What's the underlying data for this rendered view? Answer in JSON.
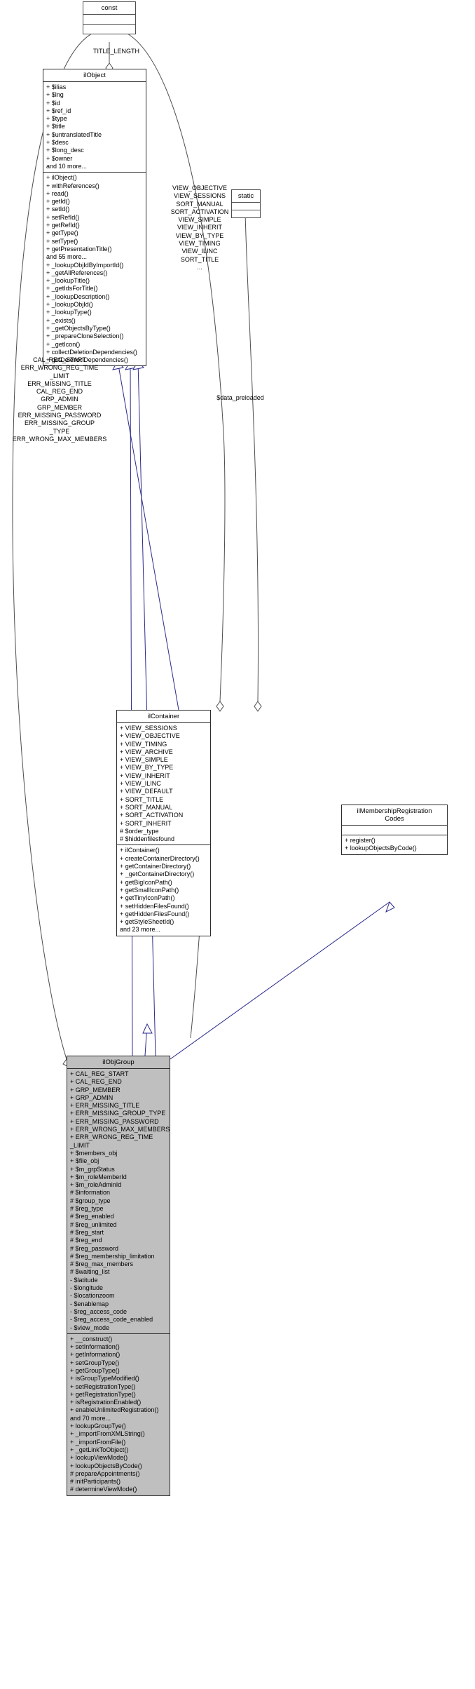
{
  "diagram": {
    "type": "uml-class-diagram",
    "subject": "ilObjGroup"
  },
  "classes": {
    "const": {
      "name": "const",
      "attributes": [],
      "operations": []
    },
    "static": {
      "name": "static",
      "attributes": [],
      "operations": []
    },
    "ilObject": {
      "name": "ilObject",
      "attributes": [
        "+ $ilias",
        "+ $lng",
        "+ $id",
        "+ $ref_id",
        "+ $type",
        "+ $title",
        "+ $untranslatedTitle",
        "+ $desc",
        "+ $long_desc",
        "+ $owner",
        "and 10 more..."
      ],
      "operations": [
        "+ ilObject()",
        "+ withReferences()",
        "+ read()",
        "+ getId()",
        "+ setId()",
        "+ setRefId()",
        "+ getRefId()",
        "+ getType()",
        "+ setType()",
        "+ getPresentationTitle()",
        "and 55 more...",
        "+ _lookupObjIdByImportId()",
        "+ _getAllReferences()",
        "+ _lookupTitle()",
        "+ _getIdsForTitle()",
        "+ _lookupDescription()",
        "+ _lookupObjId()",
        "+ _lookupType()",
        "+ _exists()",
        "+ _getObjectsByType()",
        "+ _prepareCloneSelection()",
        "+ _getIcon()",
        "+ collectDeletionDependencies()",
        "+ getDeletionDependencies()"
      ]
    },
    "ilContainer": {
      "name": "ilContainer",
      "attributes": [
        "+ VIEW_SESSIONS",
        "+ VIEW_OBJECTIVE",
        "+ VIEW_TIMING",
        "+ VIEW_ARCHIVE",
        "+ VIEW_SIMPLE",
        "+ VIEW_BY_TYPE",
        "+ VIEW_INHERIT",
        "+ VIEW_ILINC",
        "+ VIEW_DEFAULT",
        "+ SORT_TITLE",
        "+ SORT_MANUAL",
        "+ SORT_ACTIVATION",
        "+ SORT_INHERIT",
        "# $order_type",
        "# $hiddenfilesfound"
      ],
      "operations": [
        "+ ilContainer()",
        "+ createContainerDirectory()",
        "+ getContainerDirectory()",
        "+ _getContainerDirectory()",
        "+ getBigIconPath()",
        "+ getSmallIconPath()",
        "+ getTinyIconPath()",
        "+ setHiddenFilesFound()",
        "+ getHiddenFilesFound()",
        "+ getStyleSheetId()",
        "and 23 more..."
      ]
    },
    "ilMembershipRegistrationCodes": {
      "name": "ilMembershipRegistration\nCodes",
      "attributes": [],
      "operations": [
        "+ register()",
        "+ lookupObjectsByCode()"
      ]
    },
    "ilObjGroup": {
      "name": "ilObjGroup",
      "attributes": [
        "+ CAL_REG_START",
        "+ CAL_REG_END",
        "+ GRP_MEMBER",
        "+ GRP_ADMIN",
        "+ ERR_MISSING_TITLE",
        "+ ERR_MISSING_GROUP_TYPE",
        "+ ERR_MISSING_PASSWORD",
        "+ ERR_WRONG_MAX_MEMBERS",
        "+ ERR_WRONG_REG_TIME",
        "_LIMIT",
        "+ $members_obj",
        "+ $file_obj",
        "+ $m_grpStatus",
        "+ $m_roleMemberId",
        "+ $m_roleAdminId",
        "# $information",
        "# $group_type",
        "# $reg_type",
        "# $reg_enabled",
        "# $reg_unlimited",
        "# $reg_start",
        "# $reg_end",
        "# $reg_password",
        "# $reg_membership_limitation",
        "# $reg_max_members",
        "# $waiting_list",
        "- $latitude",
        "- $longitude",
        "- $locationzoom",
        "- $enablemap",
        "- $reg_access_code",
        "- $reg_access_code_enabled",
        "- $view_mode"
      ],
      "operations": [
        "+ __construct()",
        "+ setInformation()",
        "+ getInformation()",
        "+ setGroupType()",
        "+ getGroupType()",
        "+ isGroupTypeModified()",
        "+ setRegistrationType()",
        "+ getRegistrationType()",
        "+ isRegistrationEnabled()",
        "+ enableUnlimitedRegistration()",
        "and 70 more...",
        "+ lookupGroupTye()",
        "+ _importFromXMLString()",
        "+ _importFromFile()",
        "+ _getLinkToObject()",
        "+ lookupViewMode()",
        "+ lookupObjectsByCode()",
        "# prepareAppointments()",
        "# initParticipants()",
        "# determineViewMode()"
      ]
    }
  },
  "edge_labels": {
    "title_length": "TITLE_LENGTH",
    "container_consts": "VIEW_OBJECTIVE\nVIEW_SESSIONS\nSORT_MANUAL\nSORT_ACTIVATION\nVIEW_SIMPLE\nVIEW_INHERIT\nVIEW_BY_TYPE\nVIEW_TIMING\nVIEW_ILINC\nSORT_TITLE\n...",
    "group_consts": "CAL_REG_START\nERR_WRONG_REG_TIME\n_LIMIT\nERR_MISSING_TITLE\nCAL_REG_END\nGRP_ADMIN\nGRP_MEMBER\nERR_MISSING_PASSWORD\nERR_MISSING_GROUP\n_TYPE\nERR_WRONG_MAX_MEMBERS",
    "data_preloaded": "$data_preloaded"
  },
  "colors": {
    "edge_inheritance": "#2a2a8c",
    "edge_association": "#4d4d4d",
    "box_border": "#2b2b2b",
    "box_fill": "#ffffff",
    "box_fill_highlight": "#bfbfbf"
  }
}
